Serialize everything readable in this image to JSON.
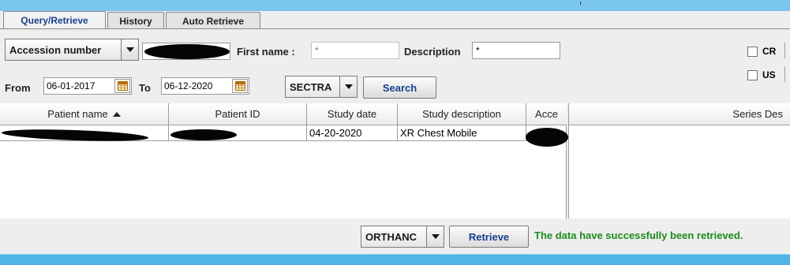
{
  "tabs": [
    {
      "label": "Query/Retrieve",
      "active": true
    },
    {
      "label": "History",
      "active": false
    },
    {
      "label": "Auto Retrieve",
      "active": false
    }
  ],
  "query": {
    "search_field": "Accession number",
    "first_name_label": "First name :",
    "first_name_placeholder": "*",
    "description_label": "Description",
    "description_value": "*",
    "from_label": "From",
    "from_date": "06-01-2017",
    "to_label": "To",
    "to_date": "06-12-2020",
    "source_node": "SECTRA",
    "search_button": "Search"
  },
  "modalities": [
    {
      "label": "CR",
      "checked": false
    },
    {
      "label": "US",
      "checked": false
    }
  ],
  "table": {
    "columns": [
      "Patient name",
      "Patient ID",
      "Study date",
      "Study description",
      "Acce"
    ],
    "sorted_column": "Patient name",
    "sort_direction": "ascending",
    "rows": [
      {
        "study_date": "04-20-2020",
        "study_description": "XR Chest Mobile"
      }
    ]
  },
  "series": {
    "header": "Series Des"
  },
  "retrieve": {
    "destination": "ORTHANC",
    "button": "Retrieve",
    "status": "The data have successfully been retrieved."
  },
  "colors": {
    "accent_blue": "#1a3f8e",
    "success_green": "#1b8d1b",
    "window_frame": "#4fb5e6"
  }
}
